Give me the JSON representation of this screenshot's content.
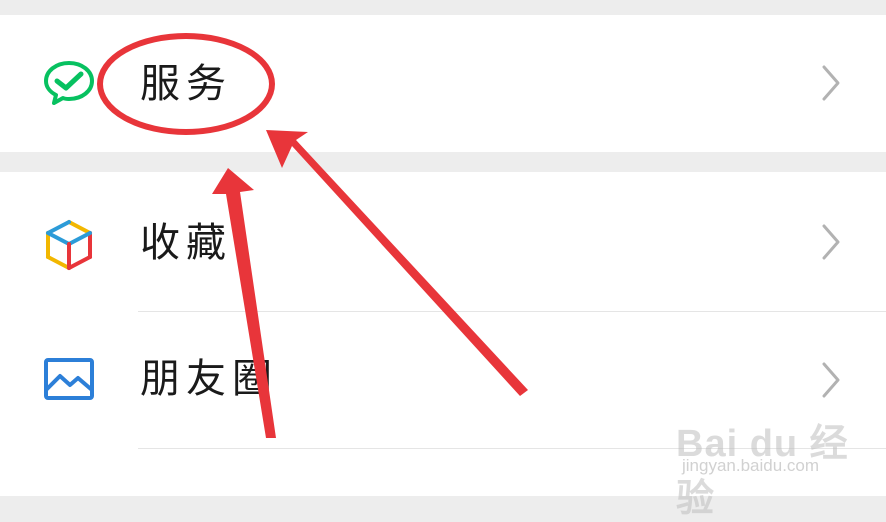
{
  "menu": {
    "services": {
      "label": "服务",
      "icon": "wechat-pay-check-icon",
      "color": "#07c160"
    },
    "favorites": {
      "label": "收藏",
      "icon": "cube-icon"
    },
    "moments": {
      "label": "朋友圈",
      "icon": "landscape-image-icon",
      "color": "#2c7fd8"
    }
  },
  "annotation": {
    "color": "#e8353a"
  },
  "watermark": {
    "logo": "Bai du 经验",
    "url": "jingyan.baidu.com"
  }
}
